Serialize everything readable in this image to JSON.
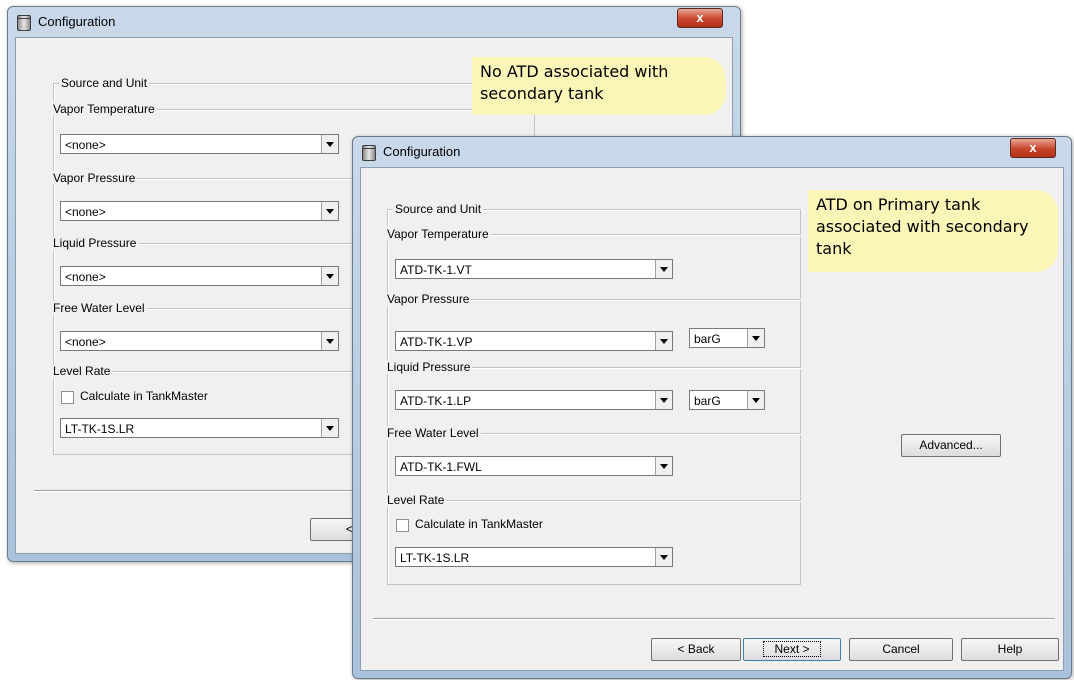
{
  "back_window": {
    "title": "Configuration",
    "close": "x",
    "group_title": "Source and Unit",
    "sections": {
      "vapor_temperature": {
        "label": "Vapor Temperature",
        "value": "<none>"
      },
      "vapor_pressure": {
        "label": "Vapor Pressure",
        "value": "<none>"
      },
      "liquid_pressure": {
        "label": "Liquid Pressure",
        "value": "<none>"
      },
      "free_water_level": {
        "label": "Free Water Level",
        "value": "<none>"
      },
      "level_rate": {
        "label": "Level Rate",
        "checkbox_label": "Calculate in TankMaster",
        "checked": false,
        "value": "LT-TK-1S.LR"
      }
    },
    "back_button": "< B"
  },
  "front_window": {
    "title": "Configuration",
    "close": "x",
    "group_title": "Source and Unit",
    "sections": {
      "vapor_temperature": {
        "label": "Vapor Temperature",
        "value": "ATD-TK-1.VT"
      },
      "vapor_pressure": {
        "label": "Vapor Pressure",
        "value": "ATD-TK-1.VP",
        "unit": "barG"
      },
      "liquid_pressure": {
        "label": "Liquid Pressure",
        "value": "ATD-TK-1.LP",
        "unit": "barG"
      },
      "free_water_level": {
        "label": "Free Water Level",
        "value": "ATD-TK-1.FWL"
      },
      "level_rate": {
        "label": "Level Rate",
        "checkbox_label": "Calculate in TankMaster",
        "checked": false,
        "value": "LT-TK-1S.LR"
      }
    },
    "advanced_button": "Advanced...",
    "buttons": {
      "back": "< Back",
      "next": "Next >",
      "cancel": "Cancel",
      "help": "Help"
    }
  },
  "callouts": {
    "back": [
      "No ATD associated with",
      "secondary tank"
    ],
    "front": [
      "ATD on Primary tank",
      "associated with secondary",
      "tank"
    ]
  }
}
